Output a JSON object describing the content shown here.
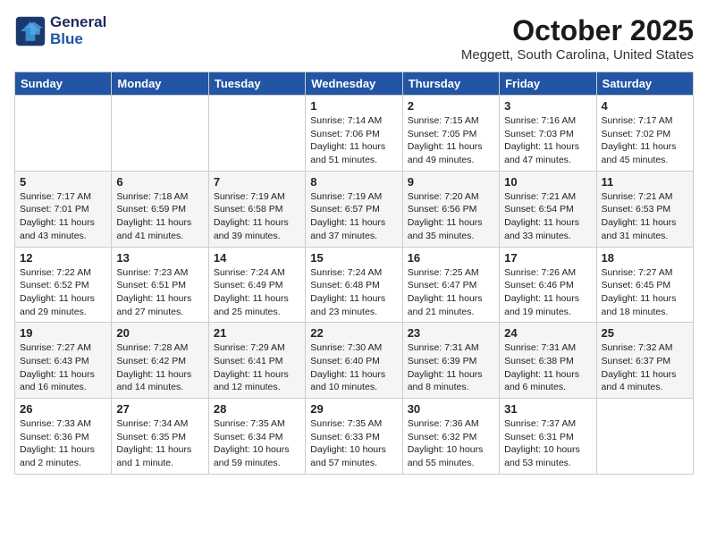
{
  "header": {
    "logo_line1": "General",
    "logo_line2": "Blue",
    "month": "October 2025",
    "location": "Meggett, South Carolina, United States"
  },
  "weekdays": [
    "Sunday",
    "Monday",
    "Tuesday",
    "Wednesday",
    "Thursday",
    "Friday",
    "Saturday"
  ],
  "weeks": [
    [
      {
        "day": "",
        "info": ""
      },
      {
        "day": "",
        "info": ""
      },
      {
        "day": "",
        "info": ""
      },
      {
        "day": "1",
        "info": "Sunrise: 7:14 AM\nSunset: 7:06 PM\nDaylight: 11 hours\nand 51 minutes."
      },
      {
        "day": "2",
        "info": "Sunrise: 7:15 AM\nSunset: 7:05 PM\nDaylight: 11 hours\nand 49 minutes."
      },
      {
        "day": "3",
        "info": "Sunrise: 7:16 AM\nSunset: 7:03 PM\nDaylight: 11 hours\nand 47 minutes."
      },
      {
        "day": "4",
        "info": "Sunrise: 7:17 AM\nSunset: 7:02 PM\nDaylight: 11 hours\nand 45 minutes."
      }
    ],
    [
      {
        "day": "5",
        "info": "Sunrise: 7:17 AM\nSunset: 7:01 PM\nDaylight: 11 hours\nand 43 minutes."
      },
      {
        "day": "6",
        "info": "Sunrise: 7:18 AM\nSunset: 6:59 PM\nDaylight: 11 hours\nand 41 minutes."
      },
      {
        "day": "7",
        "info": "Sunrise: 7:19 AM\nSunset: 6:58 PM\nDaylight: 11 hours\nand 39 minutes."
      },
      {
        "day": "8",
        "info": "Sunrise: 7:19 AM\nSunset: 6:57 PM\nDaylight: 11 hours\nand 37 minutes."
      },
      {
        "day": "9",
        "info": "Sunrise: 7:20 AM\nSunset: 6:56 PM\nDaylight: 11 hours\nand 35 minutes."
      },
      {
        "day": "10",
        "info": "Sunrise: 7:21 AM\nSunset: 6:54 PM\nDaylight: 11 hours\nand 33 minutes."
      },
      {
        "day": "11",
        "info": "Sunrise: 7:21 AM\nSunset: 6:53 PM\nDaylight: 11 hours\nand 31 minutes."
      }
    ],
    [
      {
        "day": "12",
        "info": "Sunrise: 7:22 AM\nSunset: 6:52 PM\nDaylight: 11 hours\nand 29 minutes."
      },
      {
        "day": "13",
        "info": "Sunrise: 7:23 AM\nSunset: 6:51 PM\nDaylight: 11 hours\nand 27 minutes."
      },
      {
        "day": "14",
        "info": "Sunrise: 7:24 AM\nSunset: 6:49 PM\nDaylight: 11 hours\nand 25 minutes."
      },
      {
        "day": "15",
        "info": "Sunrise: 7:24 AM\nSunset: 6:48 PM\nDaylight: 11 hours\nand 23 minutes."
      },
      {
        "day": "16",
        "info": "Sunrise: 7:25 AM\nSunset: 6:47 PM\nDaylight: 11 hours\nand 21 minutes."
      },
      {
        "day": "17",
        "info": "Sunrise: 7:26 AM\nSunset: 6:46 PM\nDaylight: 11 hours\nand 19 minutes."
      },
      {
        "day": "18",
        "info": "Sunrise: 7:27 AM\nSunset: 6:45 PM\nDaylight: 11 hours\nand 18 minutes."
      }
    ],
    [
      {
        "day": "19",
        "info": "Sunrise: 7:27 AM\nSunset: 6:43 PM\nDaylight: 11 hours\nand 16 minutes."
      },
      {
        "day": "20",
        "info": "Sunrise: 7:28 AM\nSunset: 6:42 PM\nDaylight: 11 hours\nand 14 minutes."
      },
      {
        "day": "21",
        "info": "Sunrise: 7:29 AM\nSunset: 6:41 PM\nDaylight: 11 hours\nand 12 minutes."
      },
      {
        "day": "22",
        "info": "Sunrise: 7:30 AM\nSunset: 6:40 PM\nDaylight: 11 hours\nand 10 minutes."
      },
      {
        "day": "23",
        "info": "Sunrise: 7:31 AM\nSunset: 6:39 PM\nDaylight: 11 hours\nand 8 minutes."
      },
      {
        "day": "24",
        "info": "Sunrise: 7:31 AM\nSunset: 6:38 PM\nDaylight: 11 hours\nand 6 minutes."
      },
      {
        "day": "25",
        "info": "Sunrise: 7:32 AM\nSunset: 6:37 PM\nDaylight: 11 hours\nand 4 minutes."
      }
    ],
    [
      {
        "day": "26",
        "info": "Sunrise: 7:33 AM\nSunset: 6:36 PM\nDaylight: 11 hours\nand 2 minutes."
      },
      {
        "day": "27",
        "info": "Sunrise: 7:34 AM\nSunset: 6:35 PM\nDaylight: 11 hours\nand 1 minute."
      },
      {
        "day": "28",
        "info": "Sunrise: 7:35 AM\nSunset: 6:34 PM\nDaylight: 10 hours\nand 59 minutes."
      },
      {
        "day": "29",
        "info": "Sunrise: 7:35 AM\nSunset: 6:33 PM\nDaylight: 10 hours\nand 57 minutes."
      },
      {
        "day": "30",
        "info": "Sunrise: 7:36 AM\nSunset: 6:32 PM\nDaylight: 10 hours\nand 55 minutes."
      },
      {
        "day": "31",
        "info": "Sunrise: 7:37 AM\nSunset: 6:31 PM\nDaylight: 10 hours\nand 53 minutes."
      },
      {
        "day": "",
        "info": ""
      }
    ]
  ]
}
